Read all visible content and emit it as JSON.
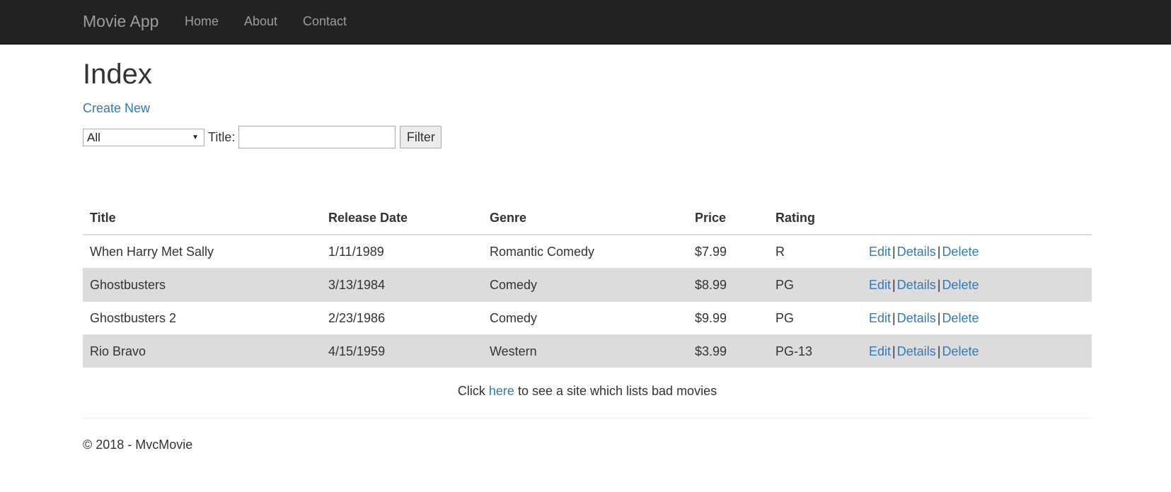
{
  "navbar": {
    "brand": "Movie App",
    "links": [
      "Home",
      "About",
      "Contact"
    ]
  },
  "page": {
    "title": "Index",
    "create_new": "Create New"
  },
  "filter": {
    "genre_selected": "All",
    "title_label": "Title:",
    "title_value": "",
    "button_label": "Filter"
  },
  "table": {
    "headers": [
      "Title",
      "Release Date",
      "Genre",
      "Price",
      "Rating"
    ],
    "rows": [
      {
        "title": "When Harry Met Sally",
        "release_date": "1/11/1989",
        "genre": "Romantic Comedy",
        "price": "$7.99",
        "rating": "R"
      },
      {
        "title": "Ghostbusters",
        "release_date": "3/13/1984",
        "genre": "Comedy",
        "price": "$8.99",
        "rating": "PG"
      },
      {
        "title": "Ghostbusters 2",
        "release_date": "2/23/1986",
        "genre": "Comedy",
        "price": "$9.99",
        "rating": "PG"
      },
      {
        "title": "Rio Bravo",
        "release_date": "4/15/1959",
        "genre": "Western",
        "price": "$3.99",
        "rating": "PG-13"
      }
    ],
    "actions": {
      "edit": "Edit",
      "details": "Details",
      "delete": "Delete",
      "separator": "|"
    }
  },
  "bad_movies": {
    "prefix": "Click",
    "link": "here",
    "suffix": "to see a site which lists bad movies"
  },
  "footer": {
    "text": "© 2018 - MvcMovie"
  },
  "colors": {
    "navbar_bg": "#222222",
    "nav_text": "#9d9d9d",
    "link": "#337ab7",
    "stripe": "#dcdcdc"
  }
}
